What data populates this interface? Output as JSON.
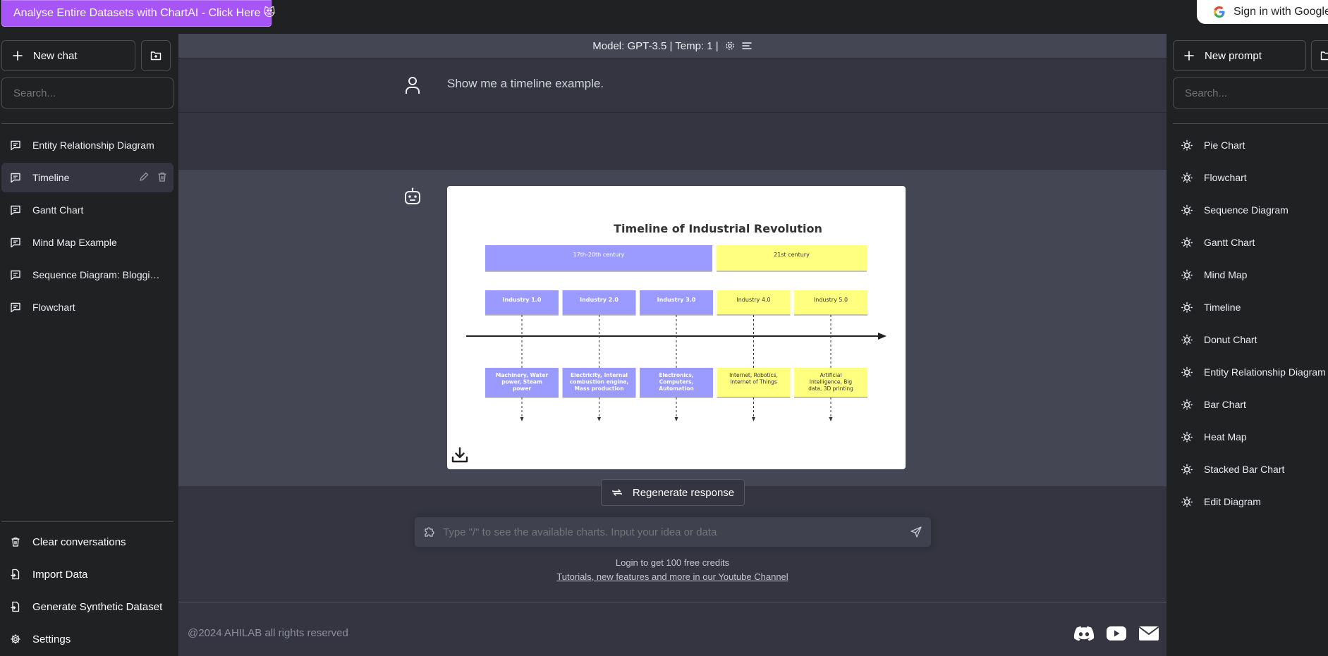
{
  "topbar": {
    "promo_label": "Analyse Entire Datasets with ChartAI - Click Here 😻",
    "signin_label": "Sign in with Google"
  },
  "left_sidebar": {
    "new_chat_label": "New chat",
    "search_placeholder": "Search...",
    "conversations": [
      {
        "label": "Entity Relationship Diagram"
      },
      {
        "label": "Timeline"
      },
      {
        "label": "Gantt Chart"
      },
      {
        "label": "Mind Map Example"
      },
      {
        "label": "Sequence Diagram: Blogging Platform"
      },
      {
        "label": "Flowchart"
      }
    ],
    "bottom_menu": [
      {
        "label": "Clear conversations",
        "icon": "trash-icon"
      },
      {
        "label": "Import Data",
        "icon": "file-import-icon"
      },
      {
        "label": "Generate Synthetic Dataset",
        "icon": "file-import-icon"
      },
      {
        "label": "Settings",
        "icon": "gear-icon"
      }
    ]
  },
  "main": {
    "model_bar": "Model: GPT-3.5 | Temp: 1 |",
    "user_message": "Show me a timeline example.",
    "regenerate_label": "Regenerate response",
    "input_placeholder": "Type \"/\" to see the available charts. Input your idea or data",
    "credits_text": "Login to get 100 free credits",
    "youtube_text": "Tutorials, new features and more in our Youtube Channel",
    "copyright": "@2024 AHILAB all rights reserved"
  },
  "right_sidebar": {
    "new_prompt_label": "New prompt",
    "search_placeholder": "Search...",
    "prompts": [
      {
        "label": "Pie Chart"
      },
      {
        "label": "Flowchart"
      },
      {
        "label": "Sequence Diagram"
      },
      {
        "label": "Gantt Chart"
      },
      {
        "label": "Mind Map"
      },
      {
        "label": "Timeline"
      },
      {
        "label": "Donut Chart"
      },
      {
        "label": "Entity Relationship Diagram"
      },
      {
        "label": "Bar Chart"
      },
      {
        "label": "Heat Map"
      },
      {
        "label": "Stacked Bar Chart"
      },
      {
        "label": "Edit Diagram"
      }
    ]
  },
  "timeline": {
    "title": "Timeline of Industrial Revolution",
    "colors": {
      "purple": "#9b9bff",
      "yellow": "#ffff80"
    },
    "periods": [
      {
        "label": "17th-20th century",
        "color": "purple"
      },
      {
        "label": "21st century",
        "color": "yellow"
      }
    ],
    "events": [
      {
        "label": "Industry 1.0",
        "detail": [
          "Machinery, Water",
          "power, Steam",
          "power"
        ],
        "color": "purple"
      },
      {
        "label": "Industry 2.0",
        "detail": [
          "Electricity, Internal",
          "combustion engine,",
          "Mass production"
        ],
        "color": "purple"
      },
      {
        "label": "Industry 3.0",
        "detail": [
          "Electronics,",
          "Computers,",
          "Automation"
        ],
        "color": "purple"
      },
      {
        "label": "Industry 4.0",
        "detail": [
          "Internet, Robotics,",
          "Internet of Things"
        ],
        "color": "yellow"
      },
      {
        "label": "Industry 5.0",
        "detail": [
          "Artificial",
          "Intelligence, Big",
          "data, 3D printing"
        ],
        "color": "yellow"
      }
    ]
  }
}
